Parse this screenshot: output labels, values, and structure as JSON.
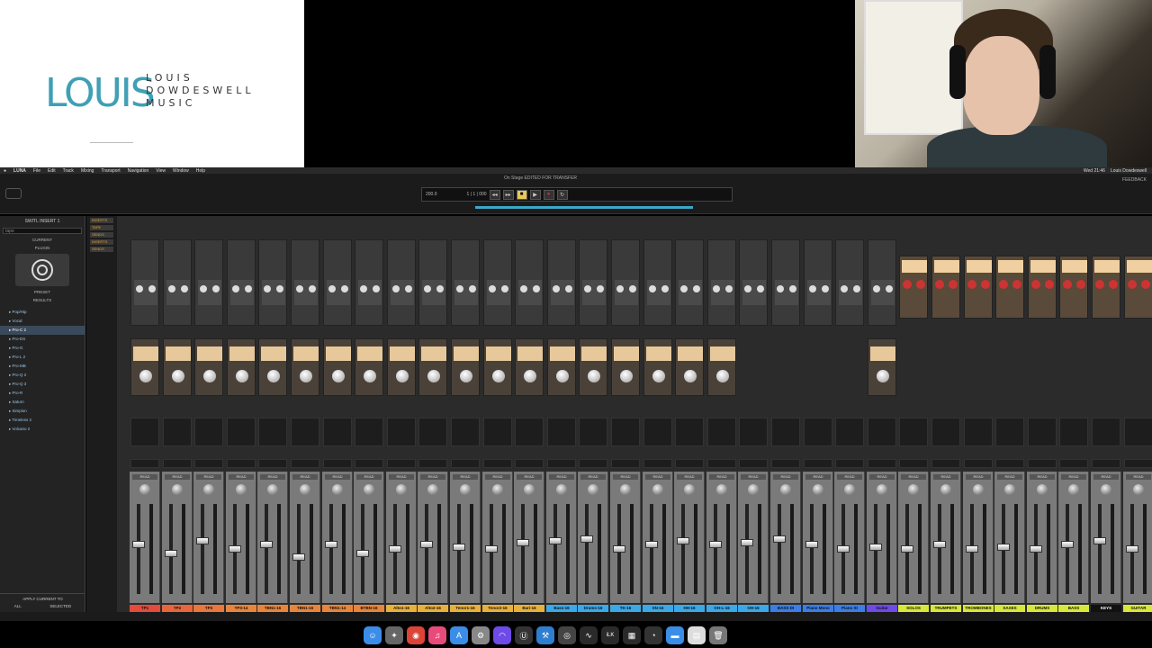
{
  "logo": {
    "main": "LOUIS",
    "sub": "LOUIS DOWDESWELL MUSIC"
  },
  "menubar": {
    "items": [
      "LUNA",
      "File",
      "Edit",
      "Track",
      "Mixing",
      "Transport",
      "Navigation",
      "View",
      "Window",
      "Help"
    ],
    "clock": "Wed 21:46",
    "user": "Louis Dowdeswell"
  },
  "transport": {
    "window_title": "On Stage EDITED FOR TRANSFER",
    "tempo": "200.0",
    "bars": "1 | 1 | 000",
    "feedback": "FEEDBACK"
  },
  "sidebar": {
    "title": "SWITL INSERT 1",
    "search": "tape",
    "current": "CURRENT",
    "plugin": "PLUGIN",
    "preset": "PRESET",
    "results": "RESULTS",
    "items": [
      "Pop/Hip",
      "Vocal",
      "Pro-C 2",
      "Pro-DS",
      "Pro-G",
      "Pro-L 2",
      "Pro-MB",
      "Pro-Q 2",
      "Pro-Q 3",
      "Pro-R",
      "Saturn",
      "Simplon",
      "Timeless 2",
      "Volcano 2"
    ],
    "selected_index": 2,
    "apply": "APPLY CURRENT TO",
    "all": "ALL",
    "selected": "SELECTED"
  },
  "insert_tags": [
    "INSERTS",
    "TAPE",
    "SENDS",
    "INSERTS",
    "SENDS"
  ],
  "channels": [
    {
      "name": "TP1",
      "color": "#e34b3b",
      "type": "a",
      "fader": 0.55
    },
    {
      "name": "TP2",
      "color": "#e8663b",
      "type": "a",
      "fader": 0.45
    },
    {
      "name": "TP3",
      "color": "#e8783b",
      "type": "a",
      "fader": 0.6
    },
    {
      "name": "TP3-14",
      "color": "#e8853b",
      "type": "a",
      "fader": 0.5
    },
    {
      "name": "TBN1-16",
      "color": "#e8853b",
      "type": "a",
      "fader": 0.55
    },
    {
      "name": "TBN1-16",
      "color": "#e8853b",
      "type": "a",
      "fader": 0.4
    },
    {
      "name": "TBN1-14",
      "color": "#e8853b",
      "type": "a",
      "fader": 0.55
    },
    {
      "name": "BTBN-16",
      "color": "#e8853b",
      "type": "a",
      "fader": 0.45
    },
    {
      "name": "Alto1-16",
      "color": "#e8b13b",
      "type": "a",
      "fader": 0.5
    },
    {
      "name": "Alto2-16",
      "color": "#e8b13b",
      "type": "a",
      "fader": 0.55
    },
    {
      "name": "Tenor1-16",
      "color": "#e8b13b",
      "type": "a",
      "fader": 0.52
    },
    {
      "name": "Tenor2-16",
      "color": "#e8b13b",
      "type": "a",
      "fader": 0.5
    },
    {
      "name": "Bari-16",
      "color": "#e8b13b",
      "type": "a",
      "fader": 0.58
    },
    {
      "name": "Bass-16",
      "color": "#3ba8e8",
      "type": "a",
      "fader": 0.6
    },
    {
      "name": "Drums-16",
      "color": "#3ba8e8",
      "type": "a",
      "fader": 0.62
    },
    {
      "name": "TK-16",
      "color": "#3ba8e8",
      "type": "a",
      "fader": 0.5
    },
    {
      "name": "SN-16",
      "color": "#3ba8e8",
      "type": "a",
      "fader": 0.55
    },
    {
      "name": "HH-16",
      "color": "#3ba8e8",
      "type": "a",
      "fader": 0.6
    },
    {
      "name": "OH-L-16",
      "color": "#3ba8e8",
      "type": "a",
      "fader": 0.55
    },
    {
      "name": "OH-16",
      "color": "#3ba8e8",
      "type": "b",
      "fader": 0.58
    },
    {
      "name": "BASS DI",
      "color": "#3b7ee8",
      "type": "b",
      "fader": 0.62
    },
    {
      "name": "Piano Mono",
      "color": "#3b7ee8",
      "type": "b",
      "fader": 0.55
    },
    {
      "name": "Piano St",
      "color": "#3b7ee8",
      "type": "b",
      "fader": 0.5
    },
    {
      "name": "Guitar",
      "color": "#6e4be8",
      "type": "a",
      "fader": 0.52
    },
    {
      "name": "SOLOS",
      "color": "#d7e83b",
      "type": "c",
      "fader": 0.5
    },
    {
      "name": "TRUMPETS",
      "color": "#d7e83b",
      "type": "c",
      "fader": 0.55
    },
    {
      "name": "TROMBONES",
      "color": "#d7e83b",
      "type": "c",
      "fader": 0.5
    },
    {
      "name": "SAXES",
      "color": "#d7e83b",
      "type": "c",
      "fader": 0.52
    },
    {
      "name": "DRUMS",
      "color": "#d7e83b",
      "type": "c",
      "fader": 0.5
    },
    {
      "name": "BASS",
      "color": "#d7e83b",
      "type": "c",
      "fader": 0.55
    },
    {
      "name": "KEYS",
      "color": "#111111",
      "type": "c",
      "fader": 0.6
    },
    {
      "name": "GUITAR",
      "color": "#d7e83b",
      "type": "c",
      "fader": 0.5
    }
  ],
  "dock": [
    {
      "name": "finder-icon",
      "color": "#3b8de8",
      "glyph": "☺"
    },
    {
      "name": "launchpad-icon",
      "color": "#666666",
      "glyph": "✦"
    },
    {
      "name": "chrome-icon",
      "color": "#db4437",
      "glyph": "◉"
    },
    {
      "name": "music-icon",
      "color": "#e84b7a",
      "glyph": "♫"
    },
    {
      "name": "appstore-icon",
      "color": "#3b8de8",
      "glyph": "A"
    },
    {
      "name": "preferences-icon",
      "color": "#888888",
      "glyph": "⚙"
    },
    {
      "name": "luna-icon",
      "color": "#6e4be8",
      "glyph": "◠"
    },
    {
      "name": "ua-icon",
      "color": "#333333",
      "glyph": "Ⓤ"
    },
    {
      "name": "xcode-icon",
      "color": "#2e7fd0",
      "glyph": "⚒"
    },
    {
      "name": "logic-icon",
      "color": "#444444",
      "glyph": "◎"
    },
    {
      "name": "activity-icon",
      "color": "#2a2a2a",
      "glyph": "∿"
    },
    {
      "name": "ilok-icon",
      "color": "#2a2a2a",
      "glyph": "iLK"
    },
    {
      "name": "console-icon",
      "color": "#2a2a2a",
      "glyph": "▦"
    },
    {
      "name": "speed-icon",
      "color": "#333333",
      "glyph": "◔"
    },
    {
      "name": "folder-icon",
      "color": "#3b8de8",
      "glyph": "▬"
    },
    {
      "name": "document-icon",
      "color": "#dddddd",
      "glyph": "▤"
    },
    {
      "name": "trash-icon",
      "color": "#777777",
      "glyph": "🗑"
    }
  ]
}
